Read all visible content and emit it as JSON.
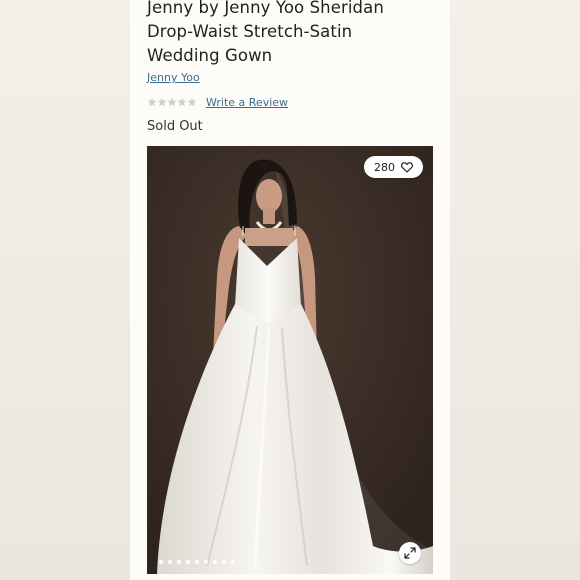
{
  "product": {
    "title_line1": "Jenny by Jenny Yoo Sheridan",
    "title_line2": "Drop-Waist Stretch-Satin",
    "title_line3": "Wedding Gown",
    "brand": "Jenny Yoo",
    "review_link": "Write a Review",
    "rating": 0,
    "rating_max": 5,
    "status": "Sold Out"
  },
  "gallery": {
    "like_count": "280",
    "like_icon": "heart-icon",
    "expand_icon": "expand-icon",
    "slide_count": 9,
    "active_slide": 1
  },
  "colors": {
    "link": "#3b6d8c",
    "star_empty": "#cfcfcf",
    "backdrop": "#3a2c24",
    "gown": "#f4f2ee"
  }
}
